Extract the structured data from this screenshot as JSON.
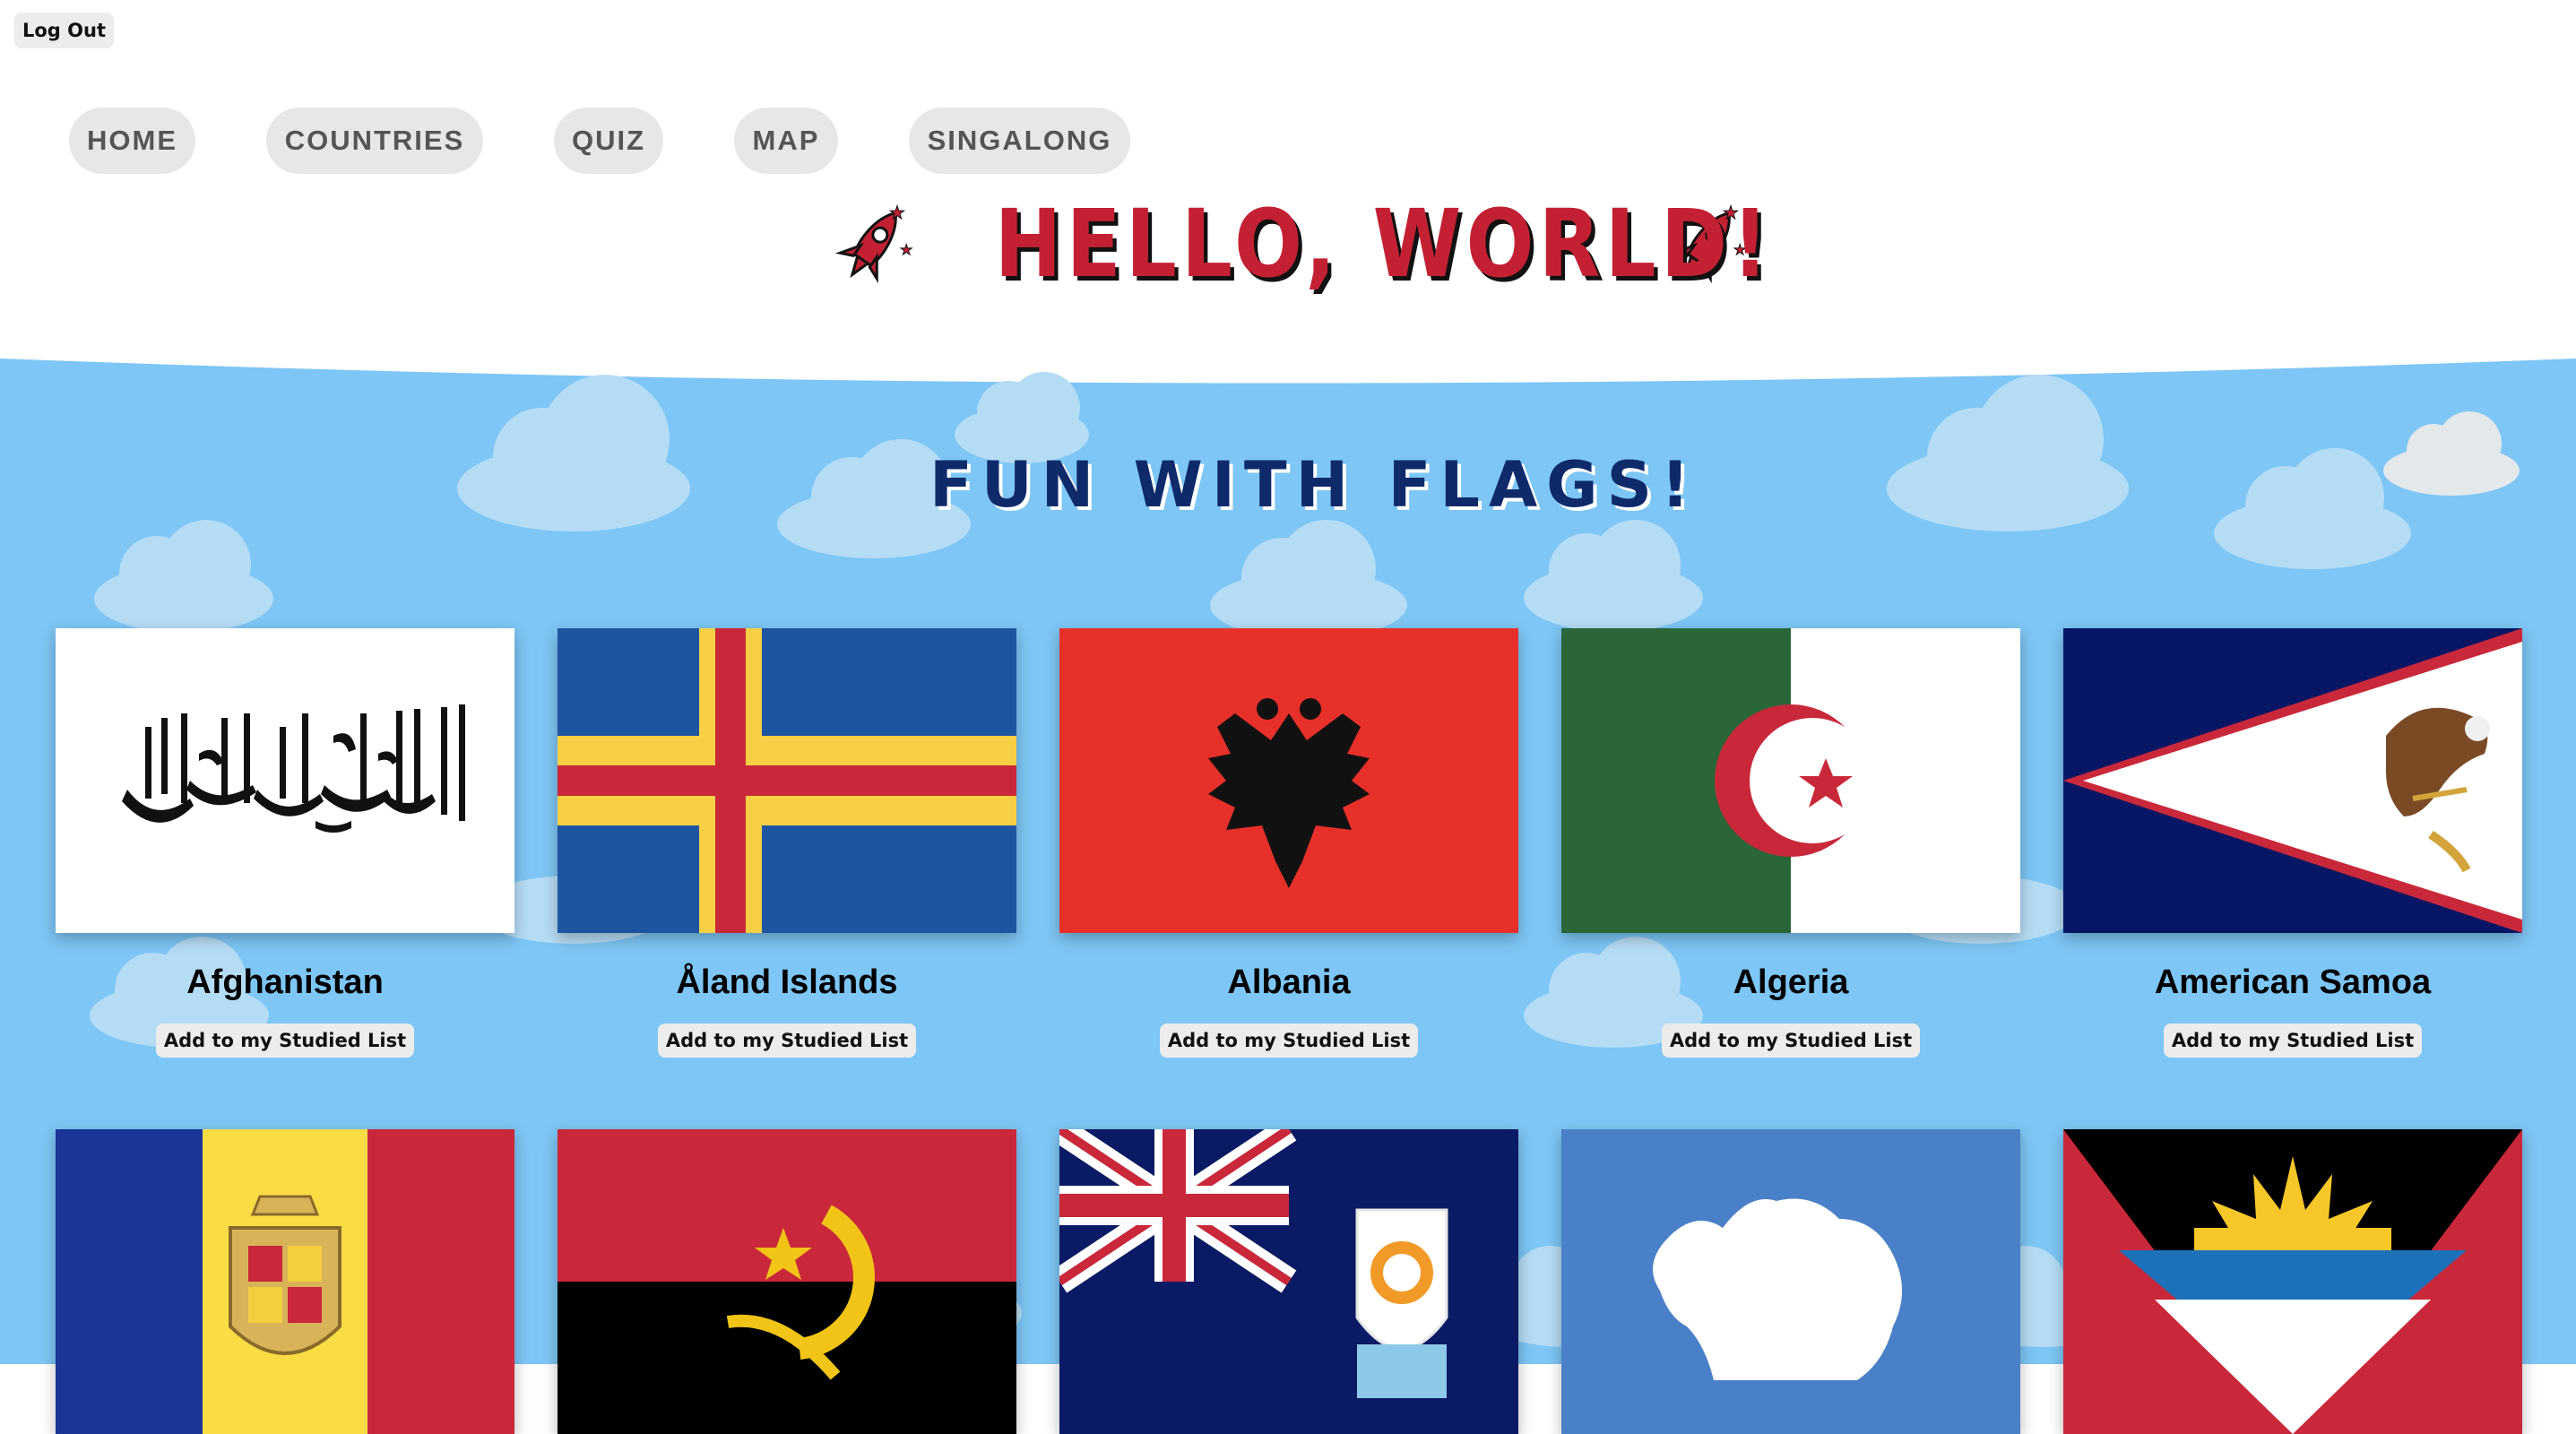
{
  "header": {
    "logout_label": "Log Out",
    "title": "HELLO, WORLD!"
  },
  "nav": [
    {
      "label": "HOME"
    },
    {
      "label": "COUNTRIES"
    },
    {
      "label": "QUIZ"
    },
    {
      "label": "MAP"
    },
    {
      "label": "SINGALONG"
    }
  ],
  "section": {
    "title": "FUN WITH FLAGS!"
  },
  "countries": [
    {
      "name": "Afghanistan",
      "button": "Add to my Studied List"
    },
    {
      "name": "Åland Islands",
      "button": "Add to my Studied List"
    },
    {
      "name": "Albania",
      "button": "Add to my Studied List"
    },
    {
      "name": "Algeria",
      "button": "Add to my Studied List"
    },
    {
      "name": "American Samoa",
      "button": "Add to my Studied List"
    },
    {
      "name": "",
      "button": ""
    },
    {
      "name": "",
      "button": ""
    },
    {
      "name": "",
      "button": ""
    },
    {
      "name": "",
      "button": ""
    },
    {
      "name": "",
      "button": ""
    }
  ],
  "colors": {
    "sky": "#7dc6f5",
    "cloud": "#b5dcf5",
    "title_red": "#c32133",
    "section_navy": "#0e2a6b",
    "nav_bg": "#e7e7e7"
  },
  "icons": [
    "rocket-icon",
    "rocket-icon"
  ]
}
